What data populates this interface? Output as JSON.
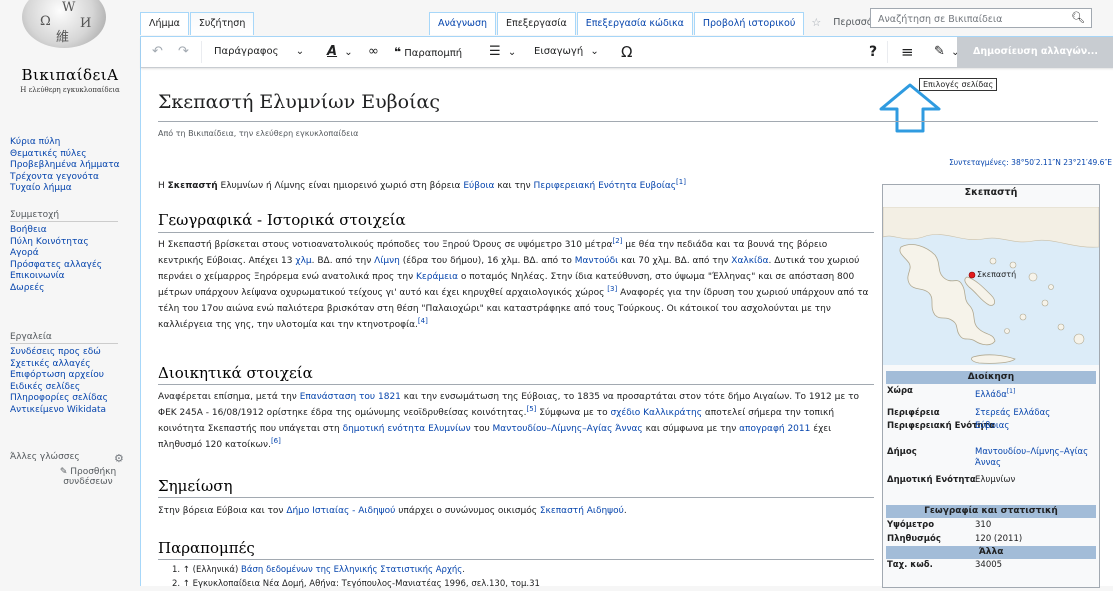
{
  "sidebar": {
    "wordmark": "ΒικιπαίδειΑ",
    "tagline": "Η ελεύθερη εγκυκλοπαίδεια",
    "nav": [
      "Κύρια πύλη",
      "Θεματικές πύλες",
      "Προβεβλημένα λήμματα",
      "Τρέχοντα γεγονότα",
      "Τυχαίο λήμμα"
    ],
    "participation_heading": "Συμμετοχή",
    "participation": [
      "Βοήθεια",
      "Πύλη Κοινότητας",
      "Αγορά",
      "Πρόσφατες αλλαγές",
      "Επικοινωνία",
      "Δωρεές"
    ],
    "tools_heading": "Εργαλεία",
    "tools": [
      "Συνδέσεις προς εδώ",
      "Σχετικές αλλαγές",
      "Επιφόρτωση αρχείου",
      "Ειδικές σελίδες",
      "Πληροφορίες σελίδας",
      "Αντικείμενο Wikidata"
    ],
    "languages_heading": "Άλλες γλώσσες",
    "add_links_line1": "✎ Προσθήκη",
    "add_links_line2": "συνδέσεων"
  },
  "tabs": {
    "article": "Λήμμα",
    "talk": "Συζήτηση",
    "read": "Ανάγνωση",
    "edit": "Επεξεργασία",
    "edit_source": "Επεξεργασία κώδικα",
    "history": "Προβολή ιστορικού",
    "more": "Περισσότερα ⌄"
  },
  "search": {
    "placeholder": "Αναζήτηση σε Βικιπαίδεια"
  },
  "toolbar": {
    "paragraph": "Παράγραφος",
    "cite": "Παραπομπή",
    "insert": "Εισαγωγή",
    "publish": "Δημοσίευση αλλαγών...",
    "tooltip": "Επιλογές σελίδας"
  },
  "article": {
    "title": "Σκεπαστή Ελυμνίων Ευβοίας",
    "from": "Από τη Βικιπαίδεια, την ελεύθερη εγκυκλοπαίδεια",
    "coords": "Συντεταγμένες: 38°50′2.11″N 23°21′49.6″E",
    "intro": "Η <b>Σκεπαστή</b> Ελυμνίων ή Λίμνης είναι ημιορεινό χωριό στη βόρεια <a>Εύβοια</a> και την <a>Περιφερειακή Ενότητα Ευβοίας</a><sup><a>[1]</a></sup>",
    "h_geo": "Γεωγραφικά - Ιστορικά στοιχεία",
    "geo": "Η Σκεπαστή βρίσκεται στους νοτιοανατολικούς πρόποδες του Ξηρού Όρους σε υψόμετρο 310 μέτρα<sup><a>[2]</a></sup> με θέα την πεδιάδα και τα βουνά της βόρειο κεντρικής Εύβοιας. Απέχει 13 <a>χλμ</a>. ΒΔ. από την <a>Λίμνη</a> (έδρα του δήμου), 16 χλμ. ΒΔ. από το <a>Μαντούδι</a> και 70 χλμ. ΒΔ. από την <a>Χαλκίδα</a>. Δυτικά του χωριού περνάει ο χείμαρρος Ξηρόρεμα ενώ ανατολικά προς την <a>Κεράμεια</a> ο ποταμός Νηλέας. Στην ίδια κατεύθυνση, στο ύψωμα \"Έλληνας\" και σε απόσταση 800 μέτρων υπάρχουν λείψανα οχυρωματικού τείχους γι' αυτό και έχει κηρυχθεί αρχαιολογικός χώρος <sup><a>[3]</a></sup> Αναφορές για την ίδρυση του χωριού υπάρχουν από τα τέλη του 17ου αιώνα ενώ παλιότερα βρισκόταν στη θέση \"Παλαιοχώρι\" και καταστράφηκε από τους Τούρκους. Οι κάτοικοί του ασχολούνται με την καλλιέργεια της γης, την υλοτομία και την κτηνοτροφία.<sup><a>[4]</a></sup>",
    "h_admin": "Διοικητικά στοιχεία",
    "admin": "Αναφέρεται επίσημα, μετά την <a>Επανάσταση του 1821</a> και την ενσωμάτωση της Εύβοιας, το 1835 να προσαρτάται στον τότε δήμο Αιγαίων. Το 1912 με το ΦΕΚ 245Α - 16/08/1912 ορίστηκε έδρα της ομώνυμης νεοϊδρυθείσας κοινότητας.<sup><a>[5]</a></sup> Σύμφωνα με το <a>σχέδιο Καλλικράτης</a> αποτελεί σήμερα την τοπική κοινότητα Σκεπαστής που υπάγεται στη <a>δημοτική ενότητα Ελυμνίων</a> του <a>Μαντουδίου–Λίμνης–Αγίας Άννας</a> και σύμφωνα με την <a>απογραφή 2011</a> έχει πληθυσμό 120 κατοίκων.<sup><a>[6]</a></sup>",
    "h_note": "Σημείωση",
    "note": "Στην βόρεια Εύβοια και τον <a>Δήμο Ιστιαίας - Αιδηψού</a> υπάρχει ο συνώνυμος οικισμός <a>Σκεπαστή Αιδηψού</a>.",
    "h_refs": "Παραπομπές",
    "ref1": "1. ↑ (Ελληνικά) <a>Βάση δεδομένων της Ελληνικής Στατιστικής Αρχής</a>.",
    "ref2": "2. ↑ Εγκυκλοπαίδεια Νέα Δομή, Αθήνα: Τεγόπουλος-Μανιατέας 1996, σελ.130, τομ.31"
  },
  "infobox": {
    "title": "Σκεπαστή",
    "map_label": "Σκεπαστή",
    "admin_header": "Διοίκηση",
    "rows_admin": [
      {
        "k": "Χώρα",
        "v": "Ελλάδα"
      },
      {
        "k": "Περιφέρεια",
        "v": "Στερεάς Ελλάδας"
      },
      {
        "k": "Περιφερειακή Ενότητα",
        "v": "Εύβοιας"
      },
      {
        "k": "Δήμος",
        "v": "Μαντουδίου–Λίμνης–Αγίας Άννας"
      },
      {
        "k": "Δημοτική Ενότητα",
        "v": "Ελυμνίων"
      }
    ],
    "country_ref": "[1]",
    "geo_header": "Γεωγραφία και στατιστική",
    "rows_geo": [
      {
        "k": "Υψόμετρο",
        "v": "310"
      },
      {
        "k": "Πληθυσμός",
        "v": "120 (2011)"
      }
    ],
    "other_header": "Άλλα",
    "rows_other": [
      {
        "k": "Ταχ. κωδ.",
        "v": "34005"
      }
    ]
  }
}
